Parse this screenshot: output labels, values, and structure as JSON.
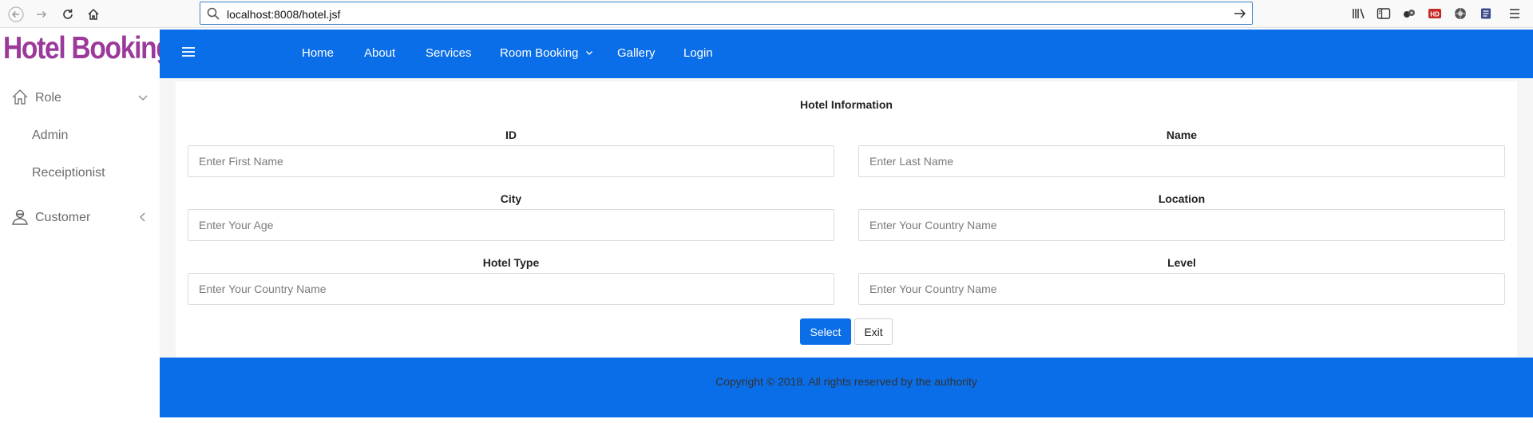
{
  "browser": {
    "url": "localhost:8008/hotel.jsf"
  },
  "sidebar": {
    "brand": "Hotel Booking",
    "items": [
      {
        "label": "Role",
        "icon": "home-icon"
      },
      {
        "label": "Admin"
      },
      {
        "label": "Receiptionist"
      },
      {
        "label": "Customer",
        "icon": "customer-icon"
      }
    ]
  },
  "nav": {
    "items": [
      "Home",
      "About",
      "Services",
      "Room Booking",
      "Gallery",
      "Login"
    ]
  },
  "form": {
    "title": "Hotel Information",
    "fields": [
      {
        "label": "ID",
        "placeholder": "Enter First Name"
      },
      {
        "label": "Name",
        "placeholder": "Enter Last Name"
      },
      {
        "label": "City",
        "placeholder": "Enter Your Age"
      },
      {
        "label": "Location",
        "placeholder": "Enter Your Country Name"
      },
      {
        "label": "Hotel Type",
        "placeholder": "Enter Your Country Name"
      },
      {
        "label": "Level",
        "placeholder": "Enter Your Country Name"
      }
    ],
    "select_label": "Select",
    "exit_label": "Exit"
  },
  "footer": {
    "text": "Copyright © 2018. All rights reserved by the authority"
  },
  "colors": {
    "primary": "#0a6ee8",
    "brand": "#9b3a9b"
  }
}
